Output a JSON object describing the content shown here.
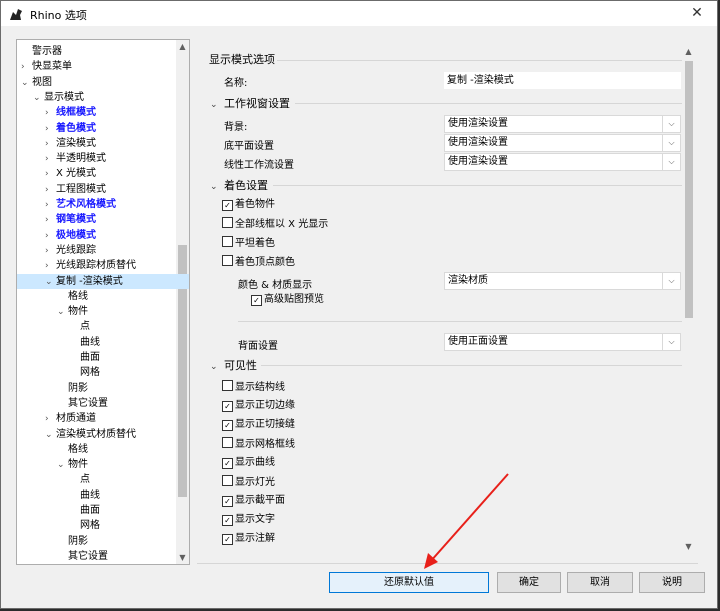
{
  "window": {
    "title": "Rhino 选项",
    "close_glyph": "✕"
  },
  "tree": {
    "items": [
      {
        "label": "警示器",
        "exp": "",
        "indent": 0,
        "style": ""
      },
      {
        "label": "快显菜单",
        "exp": "›",
        "indent": 0,
        "style": ""
      },
      {
        "label": "视图",
        "exp": "⌄",
        "indent": 0,
        "style": ""
      },
      {
        "label": "显示模式",
        "exp": "⌄",
        "indent": 1,
        "style": ""
      },
      {
        "label": "线框模式",
        "exp": "›",
        "indent": 2,
        "style": "blue"
      },
      {
        "label": "着色模式",
        "exp": "›",
        "indent": 2,
        "style": "blue"
      },
      {
        "label": "渲染模式",
        "exp": "›",
        "indent": 2,
        "style": ""
      },
      {
        "label": "半透明模式",
        "exp": "›",
        "indent": 2,
        "style": ""
      },
      {
        "label": "X 光模式",
        "exp": "›",
        "indent": 2,
        "style": ""
      },
      {
        "label": "工程图模式",
        "exp": "›",
        "indent": 2,
        "style": ""
      },
      {
        "label": "艺术风格模式",
        "exp": "›",
        "indent": 2,
        "style": "blue"
      },
      {
        "label": "钢笔模式",
        "exp": "›",
        "indent": 2,
        "style": "blue"
      },
      {
        "label": "极地模式",
        "exp": "›",
        "indent": 2,
        "style": "blue"
      },
      {
        "label": "光线跟踪",
        "exp": "›",
        "indent": 2,
        "style": ""
      },
      {
        "label": "光线跟踪材质替代",
        "exp": "›",
        "indent": 2,
        "style": ""
      },
      {
        "label": "复制 -渲染模式",
        "exp": "⌄",
        "indent": 2,
        "style": "sel"
      },
      {
        "label": "格线",
        "exp": "",
        "indent": 3,
        "style": ""
      },
      {
        "label": "物件",
        "exp": "⌄",
        "indent": 3,
        "style": ""
      },
      {
        "label": "点",
        "exp": "",
        "indent": 4,
        "style": ""
      },
      {
        "label": "曲线",
        "exp": "",
        "indent": 4,
        "style": ""
      },
      {
        "label": "曲面",
        "exp": "",
        "indent": 4,
        "style": ""
      },
      {
        "label": "网格",
        "exp": "",
        "indent": 4,
        "style": ""
      },
      {
        "label": "阴影",
        "exp": "",
        "indent": 3,
        "style": ""
      },
      {
        "label": "其它设置",
        "exp": "",
        "indent": 3,
        "style": ""
      },
      {
        "label": "材质通道",
        "exp": "›",
        "indent": 2,
        "style": ""
      },
      {
        "label": "渲染模式材质替代",
        "exp": "⌄",
        "indent": 2,
        "style": ""
      },
      {
        "label": "格线",
        "exp": "",
        "indent": 3,
        "style": ""
      },
      {
        "label": "物件",
        "exp": "⌄",
        "indent": 3,
        "style": ""
      },
      {
        "label": "点",
        "exp": "",
        "indent": 4,
        "style": ""
      },
      {
        "label": "曲线",
        "exp": "",
        "indent": 4,
        "style": ""
      },
      {
        "label": "曲面",
        "exp": "",
        "indent": 4,
        "style": ""
      },
      {
        "label": "网格",
        "exp": "",
        "indent": 4,
        "style": ""
      },
      {
        "label": "阴影",
        "exp": "",
        "indent": 3,
        "style": ""
      },
      {
        "label": "其它设置",
        "exp": "",
        "indent": 3,
        "style": ""
      }
    ]
  },
  "panel": {
    "header": "显示模式选项",
    "name_label": "名称:",
    "name_value": "复制 -渲染模式",
    "viewport_section": "工作视窗设置",
    "background_label": "背景:",
    "background_value": "使用渲染设置",
    "ground_label": "底平面设置",
    "ground_value": "使用渲染设置",
    "linear_label": "线性工作流设置",
    "linear_value": "使用渲染设置",
    "shading_section": "着色设置",
    "shade_objects": {
      "label": "着色物件",
      "checked": true
    },
    "all_wire_xray": {
      "label": "全部线框以 X 光显示",
      "checked": false
    },
    "flat_shading": {
      "label": "平坦着色",
      "checked": false
    },
    "vertex_colors": {
      "label": "着色顶点颜色",
      "checked": false
    },
    "color_material_label": "颜色 & 材质显示",
    "color_material_value": "渲染材质",
    "hq_texture": {
      "label": "高级贴图预览",
      "checked": true
    },
    "backface_label": "背面设置",
    "backface_value": "使用正面设置",
    "visibility_section": "可见性",
    "visibility": [
      {
        "label": "显示结构线",
        "checked": false
      },
      {
        "label": "显示正切边缘",
        "checked": true
      },
      {
        "label": "显示正切接缝",
        "checked": true
      },
      {
        "label": "显示网格框线",
        "checked": false
      },
      {
        "label": "显示曲线",
        "checked": true
      },
      {
        "label": "显示灯光",
        "checked": false
      },
      {
        "label": "显示截平面",
        "checked": true
      },
      {
        "label": "显示文字",
        "checked": true
      },
      {
        "label": "显示注解",
        "checked": true
      }
    ]
  },
  "buttons": {
    "restore_defaults": "还原默认值",
    "ok": "确定",
    "cancel": "取消",
    "help": "说明"
  },
  "colors": {
    "accent_arrow": "#e8201a",
    "link_blue": "#1a1aff",
    "selection": "#cce8ff"
  }
}
